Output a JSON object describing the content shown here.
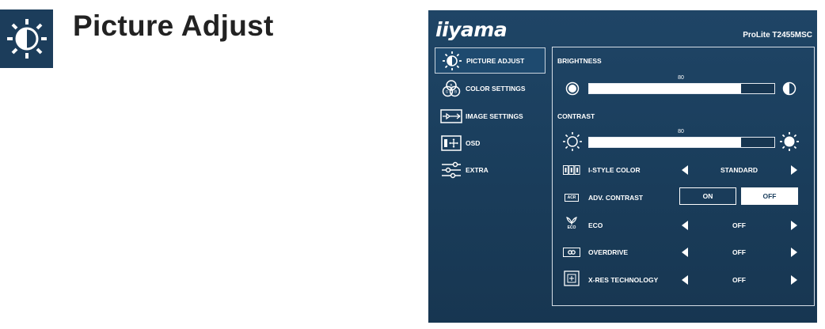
{
  "heading": {
    "title": "Picture Adjust",
    "icon": "picture-adjust-icon"
  },
  "osd": {
    "brand": "iiyama",
    "model": "ProLite T2455MSC",
    "menu": [
      {
        "label": "PICTURE ADJUST",
        "icon": "picture-adjust-icon",
        "active": true
      },
      {
        "label": "COLOR SETTINGS",
        "icon": "color-settings-icon",
        "active": false
      },
      {
        "label": "IMAGE SETTINGS",
        "icon": "image-settings-icon",
        "active": false
      },
      {
        "label": "OSD",
        "icon": "osd-icon",
        "active": false
      },
      {
        "label": "EXTRA",
        "icon": "extra-icon",
        "active": false
      }
    ],
    "brightness": {
      "label": "BRIGHTNESS",
      "value": "80",
      "level": 0.82
    },
    "contrast": {
      "label": "CONTRAST",
      "value": "80",
      "level": 0.82
    },
    "options": {
      "istyle": {
        "label": "I-STYLE COLOR",
        "value": "STANDARD"
      },
      "adv_contrast": {
        "label": "ADV. CONTRAST",
        "on": "ON",
        "off": "OFF",
        "selected": "OFF",
        "icon_text": "ACR"
      },
      "eco": {
        "label": "ECO",
        "value": "OFF",
        "icon_text": "ECO"
      },
      "overdrive": {
        "label": "OVERDRIVE",
        "value": "OFF"
      },
      "xres": {
        "label": "X-RES TECHNOLOGY",
        "value": "OFF"
      }
    }
  },
  "colors": {
    "panel": "#1b3f5e",
    "border": "#d6dee6",
    "text": "#ffffff"
  }
}
